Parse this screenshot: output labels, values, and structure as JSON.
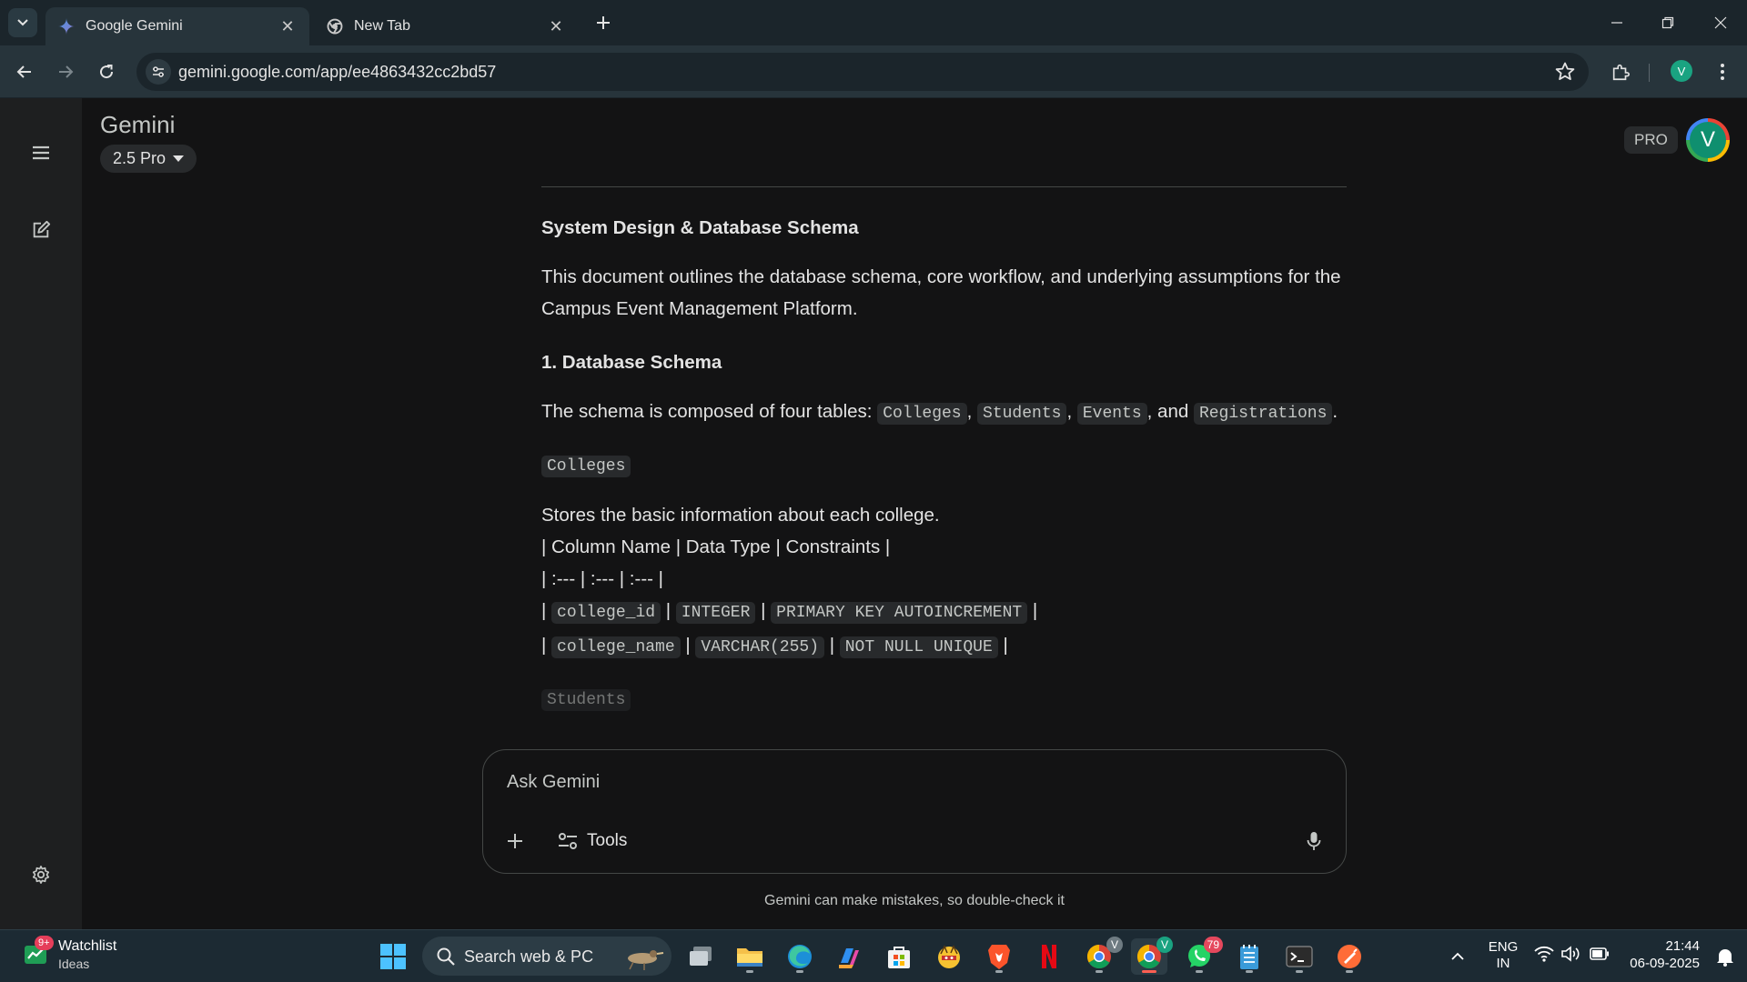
{
  "browser": {
    "tabs": [
      {
        "title": "Google Gemini",
        "active": true
      },
      {
        "title": "New Tab",
        "active": false
      }
    ],
    "close_glyph": "✕",
    "url": "gemini.google.com/app/ee4863432cc2bd57",
    "profile_initial": "V"
  },
  "app": {
    "title": "Gemini",
    "model": "2.5 Pro",
    "pro_badge": "PRO",
    "avatar_initial": "V"
  },
  "content": {
    "heading": "System Design & Database Schema",
    "intro": "This document outlines the database schema, core workflow, and underlying assumptions for the Campus Event Management Platform.",
    "section1_title": "1. Database Schema",
    "schema_sentence": {
      "prefix": "The schema is composed of four tables: ",
      "tables": [
        "Colleges",
        "Students",
        "Events",
        "Registrations"
      ],
      "sep": ", ",
      "and": ", and ",
      "end": "."
    },
    "colleges": {
      "label": "Colleges",
      "desc": "Stores the basic information about each college.",
      "header_line": "| Column Name | Data Type | Constraints |",
      "align_line": "| :--- | :--- | :--- |",
      "pipe": "|",
      "rows": [
        {
          "name": "college_id",
          "type": "INTEGER",
          "constraints": "PRIMARY KEY AUTOINCREMENT"
        },
        {
          "name": "college_name",
          "type": "VARCHAR(255)",
          "constraints": "NOT NULL UNIQUE"
        }
      ]
    },
    "students_label": "Students"
  },
  "prompt": {
    "placeholder": "Ask Gemini",
    "tools_label": "Tools"
  },
  "disclaimer": "Gemini can make mistakes, so double-check it",
  "taskbar": {
    "watchlist_title": "Watchlist",
    "watchlist_sub": "Ideas",
    "watchlist_badge": "9+",
    "search_label": "Search web & PC",
    "whatsapp_badge": "79",
    "chrome_profile_letter": "V",
    "lang_top": "ENG",
    "lang_bottom": "IN",
    "time": "21:44",
    "date": "06-09-2025"
  },
  "colors": {
    "accent_green": "#1aa381",
    "netflix_red": "#e50914",
    "brave_orange": "#fb542b"
  }
}
